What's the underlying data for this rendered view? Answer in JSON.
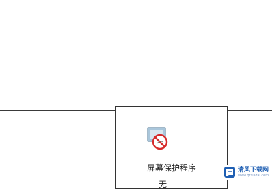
{
  "screensaver": {
    "label": "屏幕保护程序",
    "value": "无",
    "icon": "screensaver-disabled-icon"
  },
  "watermark": {
    "text": "清风下载网",
    "url": "www.qfxiazai.com",
    "colors": {
      "brand": "#1f5fb3",
      "disabled_sign": "#d62a2a"
    }
  }
}
